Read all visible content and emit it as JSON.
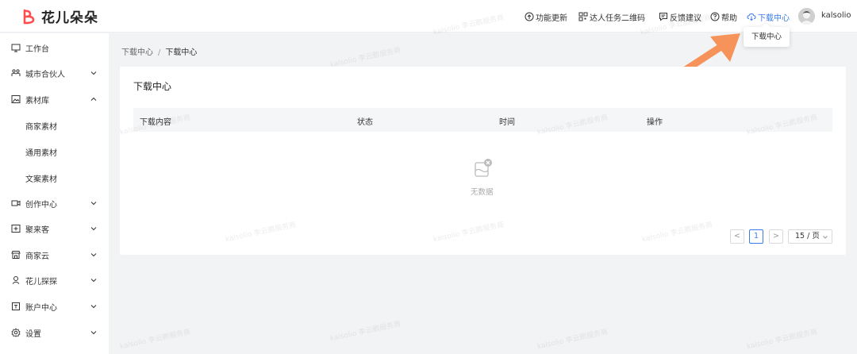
{
  "app": {
    "brand": "花儿朵朵",
    "accent_color": "#3a7ce8",
    "brand_color": "#ff4d4f"
  },
  "header": {
    "nav": [
      {
        "label": "功能更新",
        "icon": "feature-update-icon"
      },
      {
        "label": "达人任务二维码",
        "icon": "qrcode-icon"
      },
      {
        "label": "反馈建议",
        "icon": "feedback-icon"
      },
      {
        "label": "帮助",
        "icon": "help-icon"
      },
      {
        "label": "下载中心",
        "icon": "cloud-download-icon",
        "active": true
      }
    ],
    "username": "kalsolio"
  },
  "tooltip": "下载中心",
  "sidebar": {
    "items": [
      {
        "label": "工作台",
        "icon": "monitor-icon"
      },
      {
        "label": "城市合伙人",
        "icon": "partner-icon",
        "expandable": true
      },
      {
        "label": "素材库",
        "icon": "image-icon",
        "expanded": true
      },
      {
        "label": "商家素材"
      },
      {
        "label": "通用素材"
      },
      {
        "label": "文案素材"
      },
      {
        "label": "创作中心",
        "icon": "video-icon",
        "expandable": true
      },
      {
        "label": "聚来客",
        "icon": "customer-icon",
        "expandable": true
      },
      {
        "label": "商家云",
        "icon": "store-icon",
        "expandable": true
      },
      {
        "label": "花儿探探",
        "icon": "explore-icon",
        "expandable": true
      },
      {
        "label": "账户中心",
        "icon": "account-icon",
        "expandable": true
      },
      {
        "label": "设置",
        "icon": "settings-icon",
        "expandable": true
      }
    ]
  },
  "breadcrumb": {
    "parent": "下载中心",
    "separator": "/",
    "current": "下载中心"
  },
  "main": {
    "title": "下载中心",
    "columns": [
      "下载内容",
      "状态",
      "时间",
      "操作"
    ],
    "empty_text": "无数据",
    "pagination": {
      "prev": "<",
      "page": "1",
      "next": ">",
      "page_size": "15 / 页"
    }
  },
  "watermark": "kalsolio 李云鹏服务商"
}
